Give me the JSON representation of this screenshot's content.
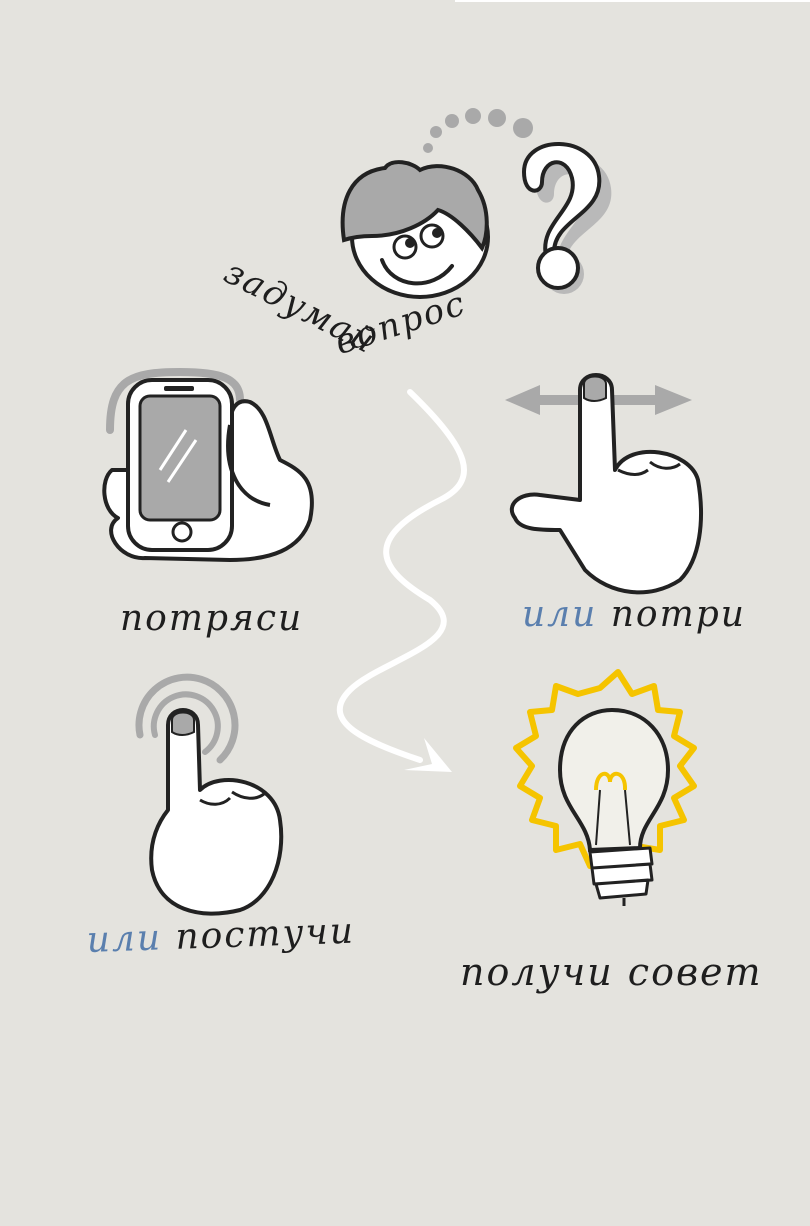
{
  "steps": {
    "think": {
      "label_part1": "задумай",
      "label_part2": "вопрос"
    },
    "shake": {
      "label": "потряси"
    },
    "rub": {
      "prefix": "или",
      "label": "потри"
    },
    "knock": {
      "prefix": "или",
      "label": "постучи"
    },
    "advice": {
      "label": "получи совет"
    }
  },
  "icons": {
    "think": "boy-face-icon",
    "question": "question-mark-icon",
    "shake": "phone-in-hand-icon",
    "rub": "finger-swipe-icon",
    "knock": "finger-tap-icon",
    "advice": "light-bulb-icon",
    "flow": "curved-arrow-icon"
  },
  "colors": {
    "background": "#e4e3de",
    "accent": "#5a7fae",
    "bulb_glow": "#f5c400",
    "gray": "#a9a9a9"
  }
}
